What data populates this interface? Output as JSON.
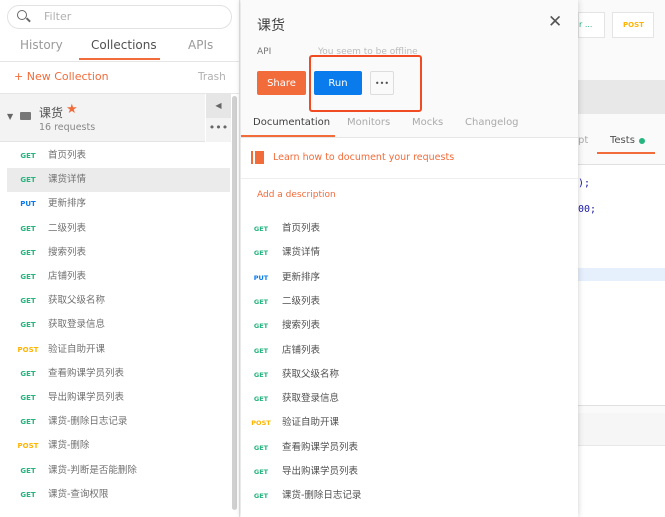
{
  "sidebar": {
    "filter_placeholder": "Filter",
    "tabs": [
      "History",
      "Collections",
      "APIs"
    ],
    "new_collection": "+ New Collection",
    "trash": "Trash",
    "collection": {
      "name": "课货",
      "count": "16 requests"
    },
    "items": [
      {
        "m": "GET",
        "n": "首页列表"
      },
      {
        "m": "GET",
        "n": "课货详情"
      },
      {
        "m": "PUT",
        "n": "更新排序"
      },
      {
        "m": "GET",
        "n": "二级列表"
      },
      {
        "m": "GET",
        "n": "搜索列表"
      },
      {
        "m": "GET",
        "n": "店铺列表"
      },
      {
        "m": "GET",
        "n": "获取父级名称"
      },
      {
        "m": "GET",
        "n": "获取登录信息"
      },
      {
        "m": "POST",
        "n": "验证自助开课"
      },
      {
        "m": "GET",
        "n": "查看购课学员列表"
      },
      {
        "m": "GET",
        "n": "导出购课学员列表"
      },
      {
        "m": "GET",
        "n": "课货-删除日志记录"
      },
      {
        "m": "POST",
        "n": "课货-删除"
      },
      {
        "m": "GET",
        "n": "课货-判断是否能删除"
      },
      {
        "m": "GET",
        "n": "课货-查询权限"
      }
    ]
  },
  "modal": {
    "title": "课货",
    "api_label": "API",
    "offline": "You seem to be offline",
    "share": "Share",
    "run": "Run",
    "more": "•••",
    "tabs": [
      "Documentation",
      "Monitors",
      "Mocks",
      "Changelog"
    ],
    "learn": "Learn how to document your requests",
    "add_desc": "Add a description",
    "items": [
      {
        "m": "GET",
        "n": "首页列表"
      },
      {
        "m": "GET",
        "n": "课货详情"
      },
      {
        "m": "PUT",
        "n": "更新排序"
      },
      {
        "m": "GET",
        "n": "二级列表"
      },
      {
        "m": "GET",
        "n": "搜索列表"
      },
      {
        "m": "GET",
        "n": "店铺列表"
      },
      {
        "m": "GET",
        "n": "获取父级名称"
      },
      {
        "m": "GET",
        "n": "获取登录信息"
      },
      {
        "m": "POST",
        "n": "验证自助开课"
      },
      {
        "m": "GET",
        "n": "查看购课学员列表"
      },
      {
        "m": "GET",
        "n": "导出购课学员列表"
      },
      {
        "m": "GET",
        "n": "课货-删除日志记录"
      }
    ]
  },
  "background": {
    "tab1": "r ...",
    "tab2": "POST",
    "tab_pt": "pt",
    "tab_tests": "Tests",
    "code1": ");",
    "code2": "00;"
  },
  "colors": {
    "accent": "#f26b3a",
    "run": "#097bed",
    "highlight": "#f04b23"
  }
}
